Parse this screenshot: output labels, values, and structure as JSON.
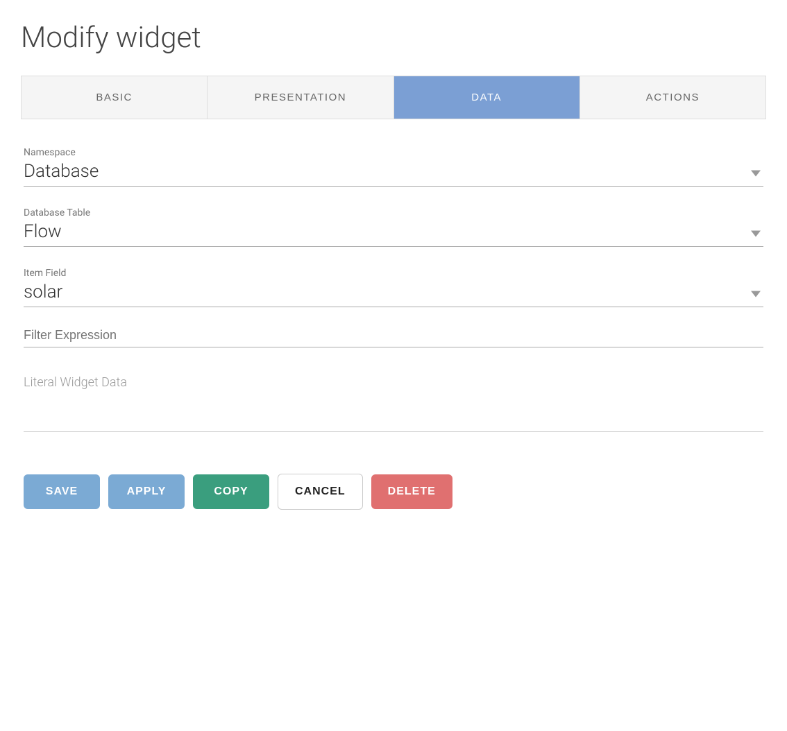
{
  "page": {
    "title": "Modify widget"
  },
  "tabs": [
    {
      "id": "basic",
      "label": "BASIC",
      "active": false
    },
    {
      "id": "presentation",
      "label": "PRESENTATION",
      "active": false
    },
    {
      "id": "data",
      "label": "DATA",
      "active": true
    },
    {
      "id": "actions",
      "label": "ACTIONS",
      "active": false
    }
  ],
  "form": {
    "namespace": {
      "label": "Namespace",
      "value": "Database"
    },
    "database_table": {
      "label": "Database Table",
      "value": "Flow"
    },
    "item_field": {
      "label": "Item Field",
      "value": "solar"
    },
    "filter_expression": {
      "placeholder": "Filter Expression"
    },
    "literal_widget_data": {
      "label": "Literal Widget Data"
    }
  },
  "buttons": {
    "save": "SAVE",
    "apply": "APPLY",
    "copy": "COPY",
    "cancel": "CANCEL",
    "delete": "DELETE"
  }
}
